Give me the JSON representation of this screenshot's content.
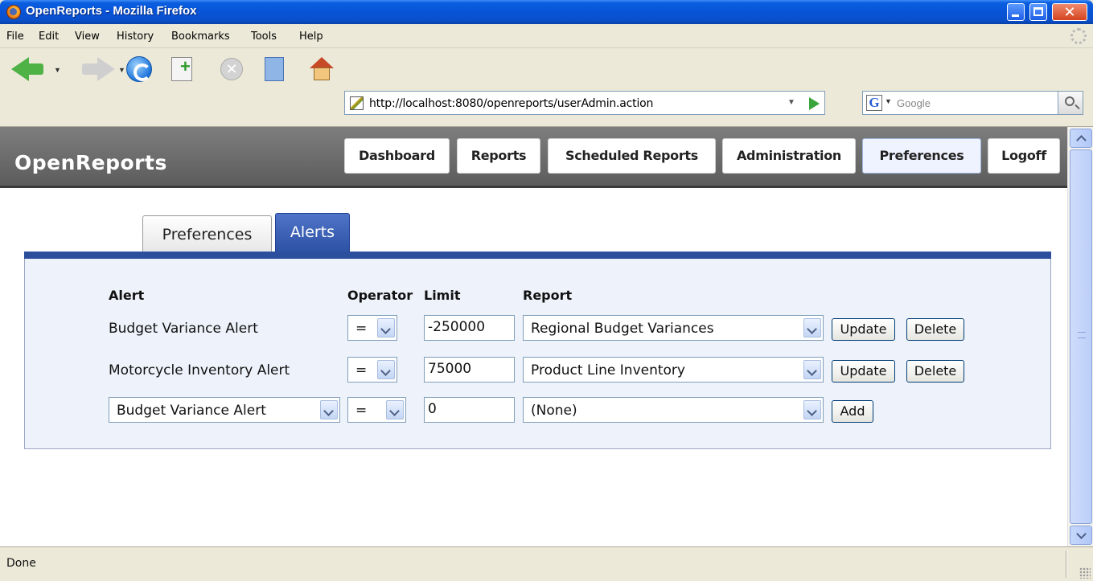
{
  "window": {
    "title": "OpenReports - Mozilla Firefox"
  },
  "menubar": {
    "items": [
      "File",
      "Edit",
      "View",
      "History",
      "Bookmarks",
      "Tools",
      "Help"
    ]
  },
  "toolbar": {
    "url": "http://localhost:8080/openreports/userAdmin.action",
    "search_placeholder": "Google",
    "search_engine_glyph": "G"
  },
  "app": {
    "logo": "OpenReports",
    "nav": [
      "Dashboard",
      "Reports",
      "Scheduled Reports",
      "Administration",
      "Preferences",
      "Logoff"
    ],
    "active_nav": "Preferences"
  },
  "tabs": {
    "items": [
      "Preferences",
      "Alerts"
    ],
    "active": "Alerts"
  },
  "alerts": {
    "headers": {
      "alert": "Alert",
      "operator": "Operator",
      "limit": "Limit",
      "report": "Report"
    },
    "rows": [
      {
        "alert": "Budget Variance Alert",
        "operator": "=",
        "limit": "-250000",
        "report": "Regional Budget Variances",
        "update_label": "Update",
        "delete_label": "Delete"
      },
      {
        "alert": "Motorcycle Inventory Alert",
        "operator": "=",
        "limit": "75000",
        "report": "Product Line Inventory",
        "update_label": "Update",
        "delete_label": "Delete"
      }
    ],
    "new_row": {
      "alert": "Budget Variance Alert",
      "operator": "=",
      "limit": "0",
      "report": "(None)",
      "add_label": "Add"
    }
  },
  "status": {
    "text": "Done"
  },
  "colors": {
    "header_bg": "#5c5c5c",
    "tab_active": "#2d52a5",
    "panel_bg": "#eef3fb",
    "titlebar": "#0854d8"
  }
}
